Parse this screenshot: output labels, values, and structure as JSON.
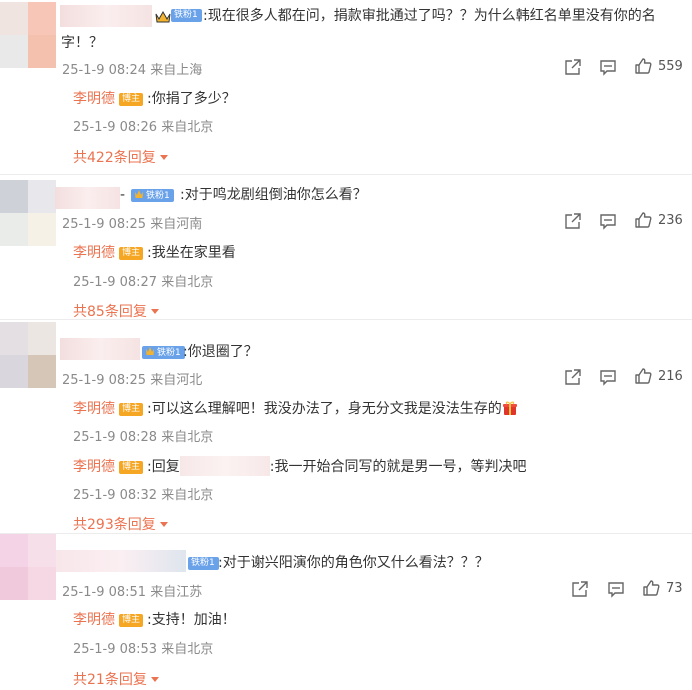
{
  "comments": [
    {
      "badge": "铁粉1",
      "text_line1": ":现在很多人都在问，捐款审批通过了吗？？为什么韩红名单里没有你的名",
      "text_line2": "字！？",
      "meta": "25-1-9 08:24 来自上海",
      "likes": "559",
      "replies": [
        {
          "author": "李明德",
          "host": "博主",
          "text": ":你捐了多少？",
          "meta": "25-1-9 08:26 来自北京"
        }
      ],
      "more": "共422条回复"
    },
    {
      "badge": "铁粉1",
      "name_suffix": "-",
      "text": ":对于鸣龙剧组倒油你怎么看？",
      "meta": "25-1-9 08:25 来自河南",
      "likes": "236",
      "replies": [
        {
          "author": "李明德",
          "host": "博主",
          "text": ":我坐在家里看",
          "meta": "25-1-9 08:27 来自北京"
        }
      ],
      "more": "共85条回复"
    },
    {
      "badge": "铁粉1",
      "text": ":你退圈了？",
      "meta": "25-1-9 08:25 来自河北",
      "likes": "216",
      "replies": [
        {
          "author": "李明德",
          "host": "博主",
          "text": ":可以这么理解吧！我没办法了，身无分文我是没法生存的",
          "meta": "25-1-9 08:28 来自北京"
        },
        {
          "author": "李明德",
          "host": "博主",
          "reply_prefix": ":回复",
          "text": ":我一开始合同写的就是男一号，等判决吧",
          "meta": "25-1-9 08:32 来自北京"
        }
      ],
      "more": "共293条回复"
    },
    {
      "badge": "铁粉1",
      "text": ":对于谢兴阳演你的角色你又什么看法？？？",
      "meta": "25-1-9 08:51 来自江苏",
      "likes": "73",
      "replies": [
        {
          "author": "李明德",
          "host": "博主",
          "text": ":支持！加油！",
          "meta": "25-1-9 08:53 来自北京"
        }
      ],
      "more": "共21条回复"
    }
  ],
  "colors": {
    "accent": "#eb7350",
    "badge_blue": "#6aa2ea",
    "host_orange": "#f5a623",
    "meta_gray": "#8a8a8a"
  },
  "icons": [
    "share-icon",
    "comment-icon",
    "like-icon",
    "crown-icon",
    "gift-icon"
  ]
}
